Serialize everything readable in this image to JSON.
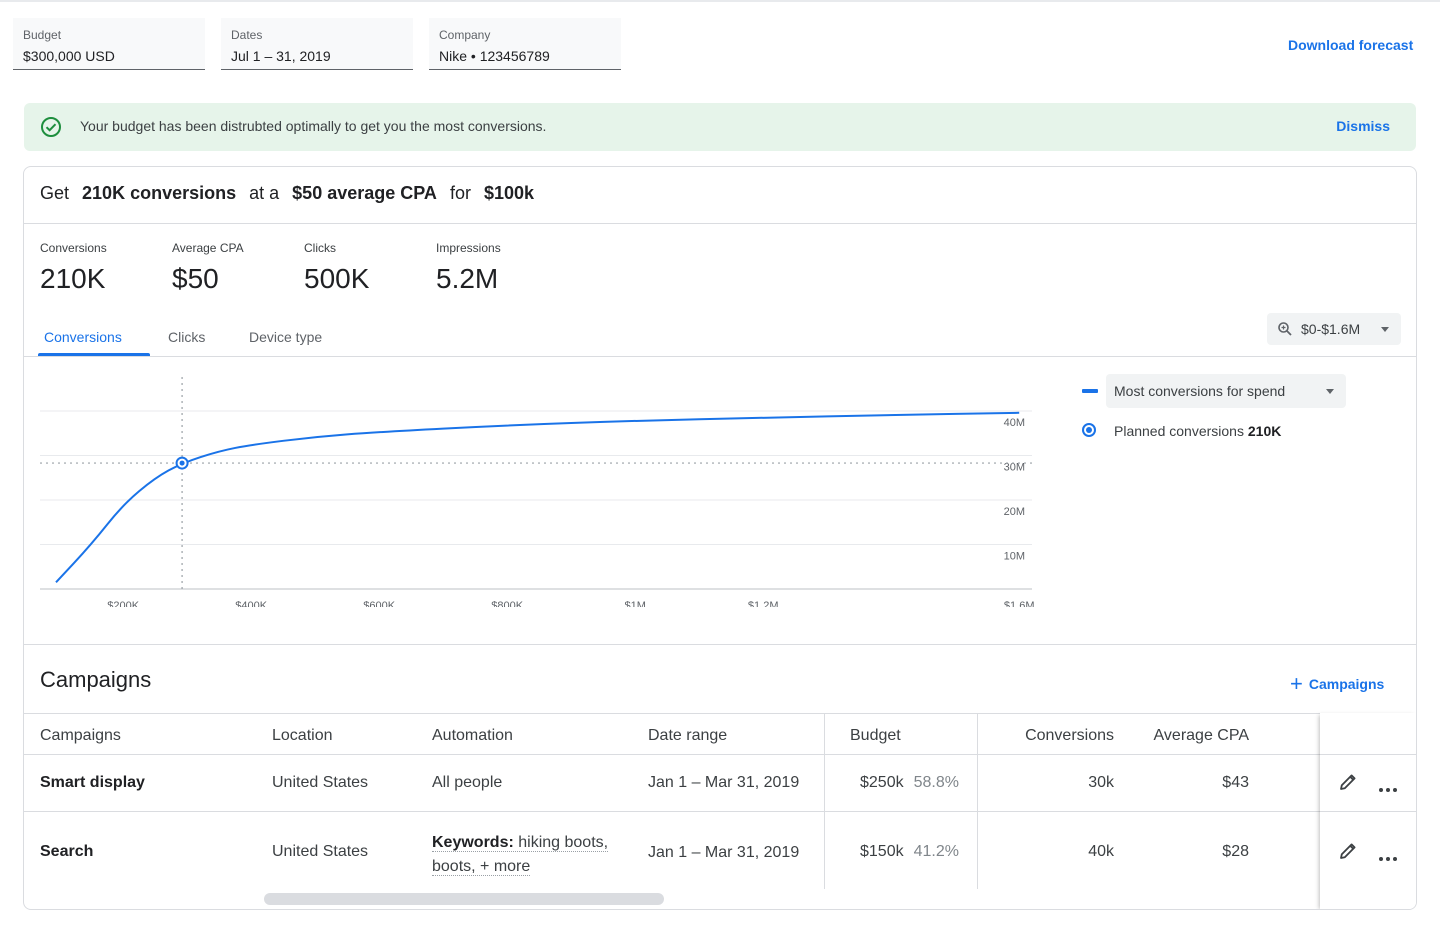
{
  "filters": {
    "budget": {
      "label": "Budget",
      "value": "$300,000 USD"
    },
    "dates": {
      "label": "Dates",
      "value": "Jul 1 – 31, 2019"
    },
    "company": {
      "label": "Company",
      "value": "Nike • 123456789"
    }
  },
  "download_label": "Download forecast",
  "banner": {
    "message": "Your budget has been distrubted optimally to get you the most conversions.",
    "dismiss": "Dismiss",
    "color": "#e6f4ea"
  },
  "headline": {
    "p1": "Get",
    "v1": "210K conversions",
    "p2": "at a",
    "v2": "$50 average CPA",
    "p3": "for",
    "v3": "$100k"
  },
  "metrics": [
    {
      "label": "Conversions",
      "value": "210K"
    },
    {
      "label": "Average CPA",
      "value": "$50"
    },
    {
      "label": "Clicks",
      "value": "500K"
    },
    {
      "label": "Impressions",
      "value": "5.2M"
    }
  ],
  "tabs": [
    {
      "label": "Conversions",
      "active": true
    },
    {
      "label": "Clicks",
      "active": false
    },
    {
      "label": "Device type",
      "active": false
    }
  ],
  "range_selector": "$0-$1.6M",
  "legend": {
    "series_dropdown": "Most conversions for spend",
    "planned_label": "Planned conversions",
    "planned_value": "210K"
  },
  "chart_data": {
    "type": "line",
    "x_tick_labels": [
      "$200K",
      "$400K",
      "$600K",
      "$800K",
      "$1M",
      "$1.2M",
      "$1.6M"
    ],
    "x_ticks": [
      200000,
      400000,
      600000,
      800000,
      1000000,
      1200000,
      1600000
    ],
    "y_tick_labels": [
      "10M",
      "20M",
      "30M",
      "40M"
    ],
    "y_ticks": [
      10,
      20,
      30,
      40
    ],
    "ylim": [
      0,
      40
    ],
    "xlim": [
      70000,
      1620000
    ],
    "series": [
      {
        "color": "#1a73e8",
        "x": [
          95000,
          150000,
          200000,
          250000,
          292000,
          350000,
          400000,
          500000,
          600000,
          800000,
          1000000,
          1200000,
          1400000,
          1600000
        ],
        "y": [
          1.5,
          10,
          19,
          25,
          28.3,
          31,
          32.4,
          34.2,
          35.3,
          36.8,
          37.8,
          38.5,
          39.1,
          39.6
        ]
      }
    ],
    "planned_point": {
      "x": 292000,
      "y": 28.3
    },
    "grid": true,
    "legend_position": "right"
  },
  "campaigns": {
    "title": "Campaigns",
    "add_label": "Campaigns",
    "columns": [
      "Campaigns",
      "Location",
      "Automation",
      "Date range",
      "Budget",
      "Conversions",
      "Average CPA"
    ],
    "rows": [
      {
        "name": "Smart display",
        "location": "United States",
        "automation_prefix": "",
        "automation": "All people",
        "automation_line2": "",
        "date_range": "Jan 1 – Mar 31, 2019",
        "budget": "$250k",
        "budget_pct": "58.8%",
        "conversions": "30k",
        "cpa": "$43"
      },
      {
        "name": "Search",
        "location": "United States",
        "automation_prefix": "Keywords:",
        "automation": "hiking boots,",
        "automation_line2": "boots, + more",
        "date_range": "Jan 1 – Mar 31, 2019",
        "budget": "$150k",
        "budget_pct": "41.2%",
        "conversions": "40k",
        "cpa": "$28"
      }
    ]
  },
  "colors": {
    "accent": "#1a73e8",
    "success": "#1e8e3e"
  }
}
